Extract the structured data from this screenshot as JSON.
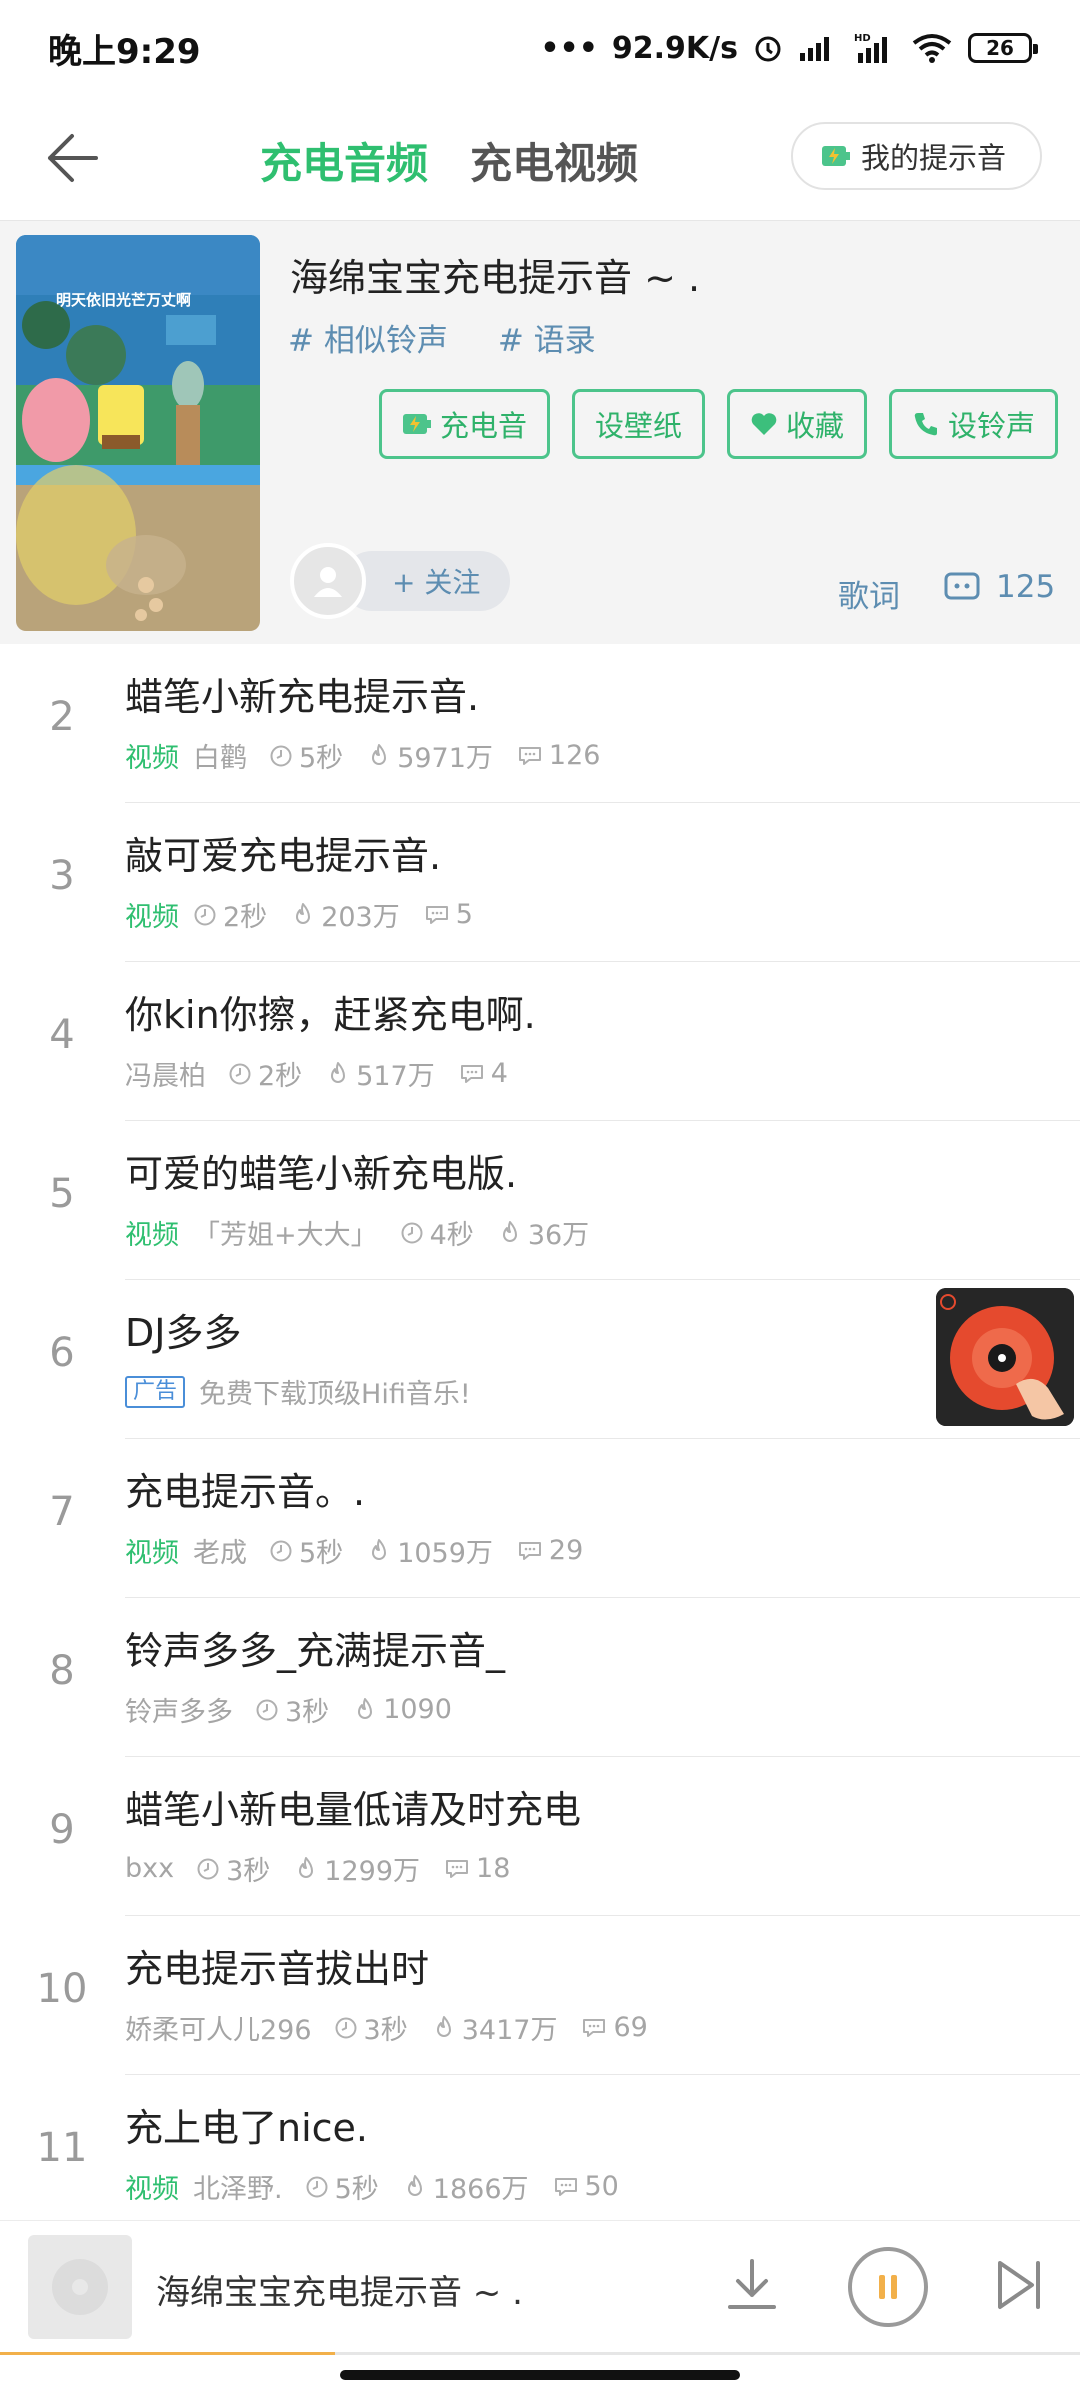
{
  "status_bar": {
    "time": "晚上9:29",
    "net_speed": "92.9K/s",
    "battery": "26"
  },
  "header": {
    "tabs": [
      {
        "label": "充电音频",
        "active": true
      },
      {
        "label": "充电视频",
        "active": false
      }
    ],
    "my_tone_label": "我的提示音"
  },
  "feature": {
    "title": "海绵宝宝充电提示音 ~ .",
    "cover_caption": "明天依旧光芒万丈啊",
    "tags": [
      "# 相似铃声",
      "# 语录"
    ],
    "actions": [
      {
        "label": "充电音",
        "icon": "battery-charge-icon"
      },
      {
        "label": "设壁纸",
        "icon": ""
      },
      {
        "label": "收藏",
        "icon": "heart-icon"
      },
      {
        "label": "设铃声",
        "icon": "phone-icon"
      }
    ],
    "follow_label": "+ 关注",
    "lyrics_label": "歌词",
    "comment_count": "125"
  },
  "items": [
    {
      "num": "2",
      "title": "蜡笔小新充电提示音.",
      "video": "视频",
      "author": "白鹳",
      "duration": "5秒",
      "plays": "5971万",
      "comments": "126"
    },
    {
      "num": "3",
      "title": "敲可爱充电提示音.",
      "video": "视频",
      "author": "",
      "duration": "2秒",
      "plays": "203万",
      "comments": "5"
    },
    {
      "num": "4",
      "title": "你kin你擦，赶紧充电啊.",
      "video": "",
      "author": "冯晨柏",
      "duration": "2秒",
      "plays": "517万",
      "comments": "4"
    },
    {
      "num": "5",
      "title": "可爱的蜡笔小新充电版.",
      "video": "视频",
      "author": "「芳姐+大大」",
      "duration": "4秒",
      "plays": "36万",
      "comments": ""
    },
    {
      "num": "6",
      "title": "DJ多多",
      "ad": true,
      "ad_badge": "广告",
      "ad_text": "免费下载顶级Hifi音乐!"
    },
    {
      "num": "7",
      "title": "充电提示音。.",
      "video": "视频",
      "author": "老成",
      "duration": "5秒",
      "plays": "1059万",
      "comments": "29"
    },
    {
      "num": "8",
      "title": "铃声多多_充满提示音_",
      "video": "",
      "author": "铃声多多",
      "duration": "3秒",
      "plays": "1090",
      "comments": ""
    },
    {
      "num": "9",
      "title": "蜡笔小新电量低请及时充电",
      "video": "",
      "author": "bxx",
      "duration": "3秒",
      "plays": "1299万",
      "comments": "18"
    },
    {
      "num": "10",
      "title": "充电提示音拔出时",
      "video": "",
      "author": "娇柔可人儿296",
      "duration": "3秒",
      "plays": "3417万",
      "comments": "69"
    },
    {
      "num": "11",
      "title": "充上电了nice.",
      "video": "视频",
      "author": "北泽野.",
      "duration": "5秒",
      "plays": "1866万",
      "comments": "50"
    }
  ],
  "player": {
    "title": "海绵宝宝充电提示音 ~ .",
    "progress": 0.31
  },
  "colors": {
    "accent_green": "#2fbf70",
    "tag_blue": "#5d8db1",
    "ad_blue": "#4a8ed8"
  }
}
